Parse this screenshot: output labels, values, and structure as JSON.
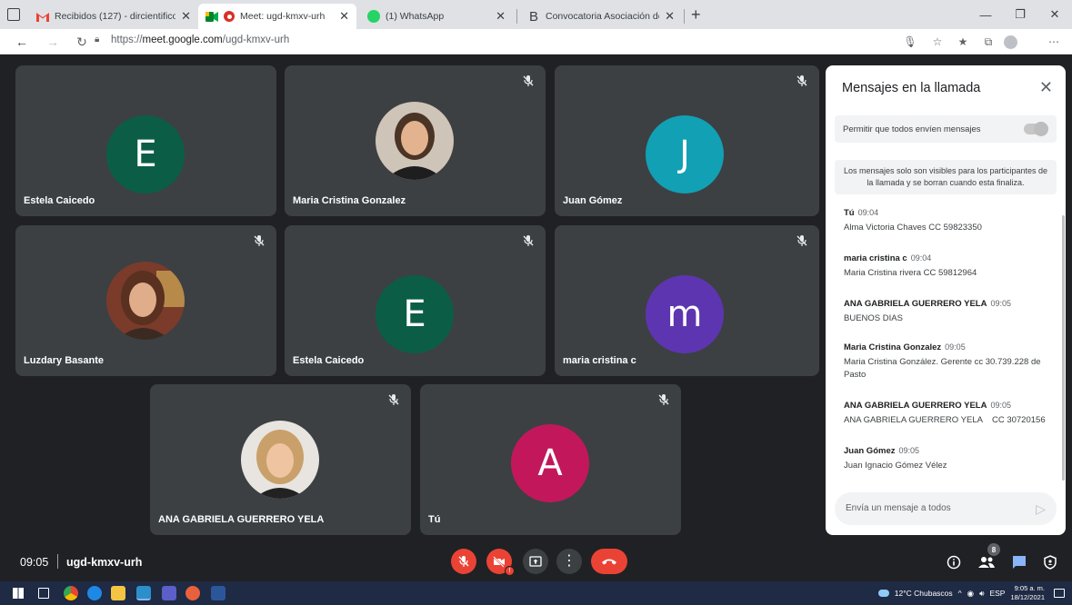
{
  "browser": {
    "tabs": [
      {
        "title": "Recibidos (127) - dircientifico@",
        "icon": "gmail-icon"
      },
      {
        "title": "Meet: ugd-kmxv-urh",
        "icon": "meet-icon",
        "active": true
      },
      {
        "title": "(1) WhatsApp",
        "icon": "whatsapp-icon"
      },
      {
        "title": "Convocatoria Asociación de Usu",
        "icon": "bootstrap-icon"
      }
    ],
    "url_prefix": "https://",
    "url_host": "meet.google.com",
    "url_path": "/ugd-kmxv-urh"
  },
  "participants": [
    {
      "name": "Estela Caicedo",
      "initial": "E",
      "color": "#0b5e45",
      "muted": false
    },
    {
      "name": "Maria Cristina Gonzalez",
      "initial": "",
      "muted": true
    },
    {
      "name": "Juan Gómez",
      "initial": "J",
      "color": "#12a0b4",
      "muted": true
    },
    {
      "name": "Luzdary Basante",
      "initial": "",
      "muted": true
    },
    {
      "name": "Estela Caicedo",
      "initial": "E",
      "color": "#0b5e45",
      "muted": true
    },
    {
      "name": "maria cristina c",
      "initial": "m",
      "color": "#5e35b1",
      "muted": true
    },
    {
      "name": "ANA GABRIELA GUERRERO YELA",
      "initial": "",
      "muted": true
    },
    {
      "name": "Tú",
      "initial": "A",
      "color": "#c2185b",
      "muted": true
    }
  ],
  "chat": {
    "title": "Mensajes en la llamada",
    "allow_label": "Permitir que todos envíen mensajes",
    "notice": "Los mensajes solo son visibles para los participantes de la llamada y se borran cuando esta finaliza.",
    "messages": [
      {
        "sender": "Tú",
        "time": "09:04",
        "text": "Alma Victoria Chaves CC 59823350"
      },
      {
        "sender": "maria cristina c",
        "time": "09:04",
        "text": "Maria Cristina rivera CC 59812964"
      },
      {
        "sender": "ANA GABRIELA GUERRERO YELA",
        "time": "09:05",
        "text": "BUENOS DIAS"
      },
      {
        "sender": "Maria Cristina Gonzalez",
        "time": "09:05",
        "text": "Maria Cristina González. Gerente cc 30.739.228 de Pasto"
      },
      {
        "sender": "ANA GABRIELA GUERRERO YELA",
        "time": "09:05",
        "text": "ANA GABRIELA GUERRERO YELA    CC 30720156"
      },
      {
        "sender": "Juan Gómez",
        "time": "09:05",
        "text": "Juan Ignacio Gómez Vélez"
      }
    ],
    "input_placeholder": "Envía un mensaje a todos"
  },
  "meeting": {
    "time": "09:05",
    "code": "ugd-kmxv-urh",
    "participant_count": "8"
  },
  "taskbar": {
    "weather": "12°C  Chubascos",
    "lang": "ESP",
    "clock_time": "9:05 a. m.",
    "clock_date": "18/12/2021"
  },
  "colors": {
    "stage_bg": "#202124",
    "tile_bg": "#3c4043",
    "control_red": "#ea4335",
    "accent_blue": "#1a73e8"
  }
}
